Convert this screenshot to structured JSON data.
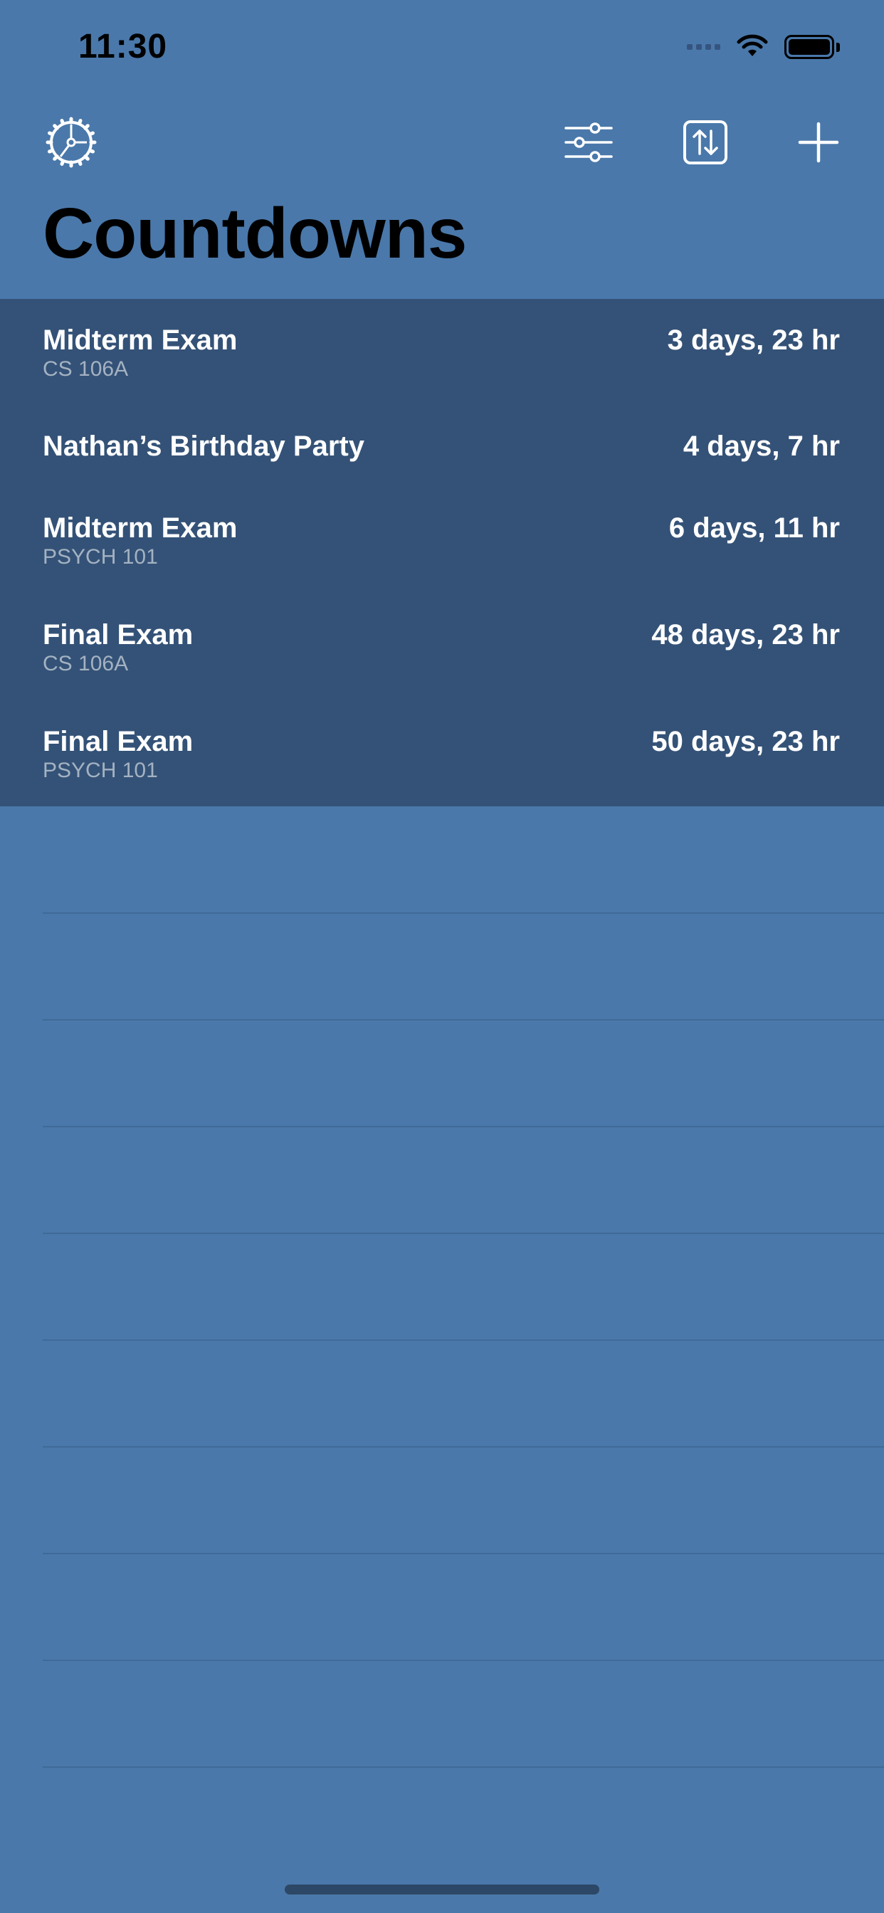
{
  "status_bar": {
    "time": "11:30",
    "signal_icon": "signal-icon",
    "wifi_icon": "wifi-icon",
    "battery_icon": "battery-icon"
  },
  "toolbar": {
    "settings_icon": "gear-icon",
    "filter_icon": "sliders-icon",
    "sort_icon": "sort-arrows-icon",
    "add_icon": "plus-icon"
  },
  "title": "Countdowns",
  "countdowns": [
    {
      "title": "Midterm Exam",
      "subtitle": "CS 106A",
      "remaining": "3 days, 23 hr"
    },
    {
      "title": "Nathan’s Birthday Party",
      "subtitle": "",
      "remaining": "4 days, 7 hr"
    },
    {
      "title": "Midterm Exam",
      "subtitle": "PSYCH 101",
      "remaining": "6 days, 11 hr"
    },
    {
      "title": "Final Exam",
      "subtitle": "CS 106A",
      "remaining": "48 days, 23 hr"
    },
    {
      "title": "Final Exam",
      "subtitle": "PSYCH 101",
      "remaining": "50 days, 23 hr"
    }
  ],
  "colors": {
    "background": "#4a78aa",
    "list_background": "#345277",
    "title_text": "#000000",
    "row_text": "#ffffff",
    "subtitle_text": "#a4b2c2"
  }
}
